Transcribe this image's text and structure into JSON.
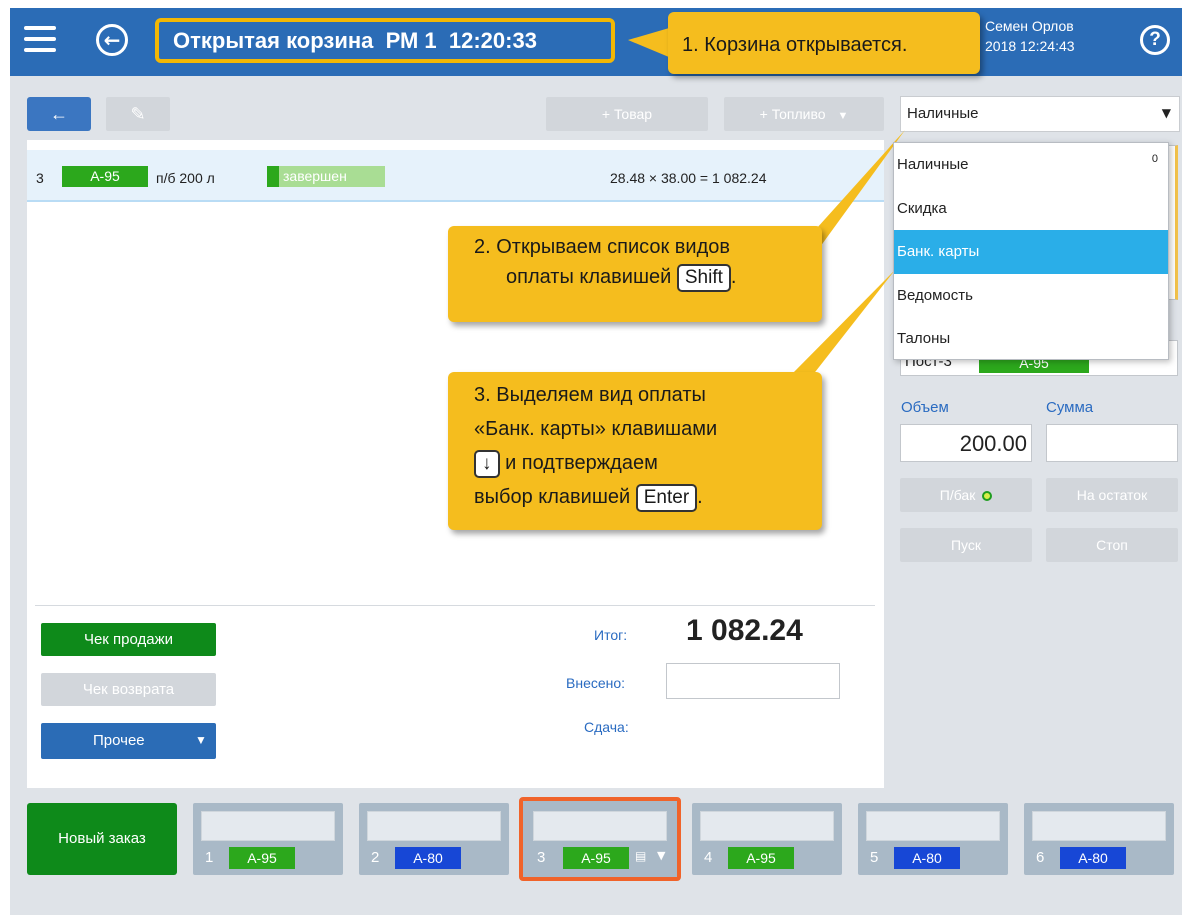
{
  "header": {
    "title": "Открытая корзина  РМ 1  12:20:33",
    "user_name": "Семен Орлов",
    "user_date": "2018 12:24:43",
    "help": "?"
  },
  "callouts": {
    "c1": "1. Корзина открывается.",
    "c2_line1": "2. Открываем список видов",
    "c2_line2": "оплаты клавишей",
    "c2_key": "Shift",
    "c2_end": ".",
    "c3_line1": "3. Выделяем вид оплаты",
    "c3_line2": "«Банк. карты» клавишами",
    "c3_key1": "↓",
    "c3_line3": "и подтверждаем",
    "c3_line4": "выбор клавишей",
    "c3_key2": "Enter",
    "c3_end": "."
  },
  "toolbar": {
    "back": "←",
    "edit": "✎",
    "add_product": "+ Товар",
    "add_fuel": "+ Топливо",
    "add_fuel_arrow": "▼"
  },
  "payment": {
    "selected": "Наличные",
    "arrow": "▼",
    "options": [
      "Наличные",
      "Скидка",
      "Банк. карты",
      "Ведомость",
      "Талоны"
    ],
    "highlighted": "Банк. карты",
    "cash_count": "0"
  },
  "row": {
    "num": "3",
    "fuel": "А-95",
    "desc": "п/б 200 л",
    "status": "завершен",
    "calc": "28.48 × 38.00 = 1 082.24"
  },
  "right_panel": {
    "post_label": "Пост-3",
    "post_fuel": "А-95",
    "volume_label": "Объем",
    "sum_label": "Сумма",
    "volume_value": "200.00",
    "sum_value": "",
    "full_tank": "П/бак",
    "remainder": "На остаток",
    "start": "Пуск",
    "stop": "Стоп"
  },
  "actions": {
    "sale_receipt": "Чек продажи",
    "return_receipt": "Чек возврата",
    "other": "Прочее",
    "other_arrow": "▼"
  },
  "totals": {
    "total_label": "Итог:",
    "total_value": "1 082.24",
    "paid_label": "Внесено:",
    "paid_value": "",
    "change_label": "Сдача:"
  },
  "orders": {
    "new_order": "Новый заказ",
    "tiles": [
      {
        "num": "1",
        "fuel": "А-95",
        "color": "green"
      },
      {
        "num": "2",
        "fuel": "А-80",
        "color": "blue"
      },
      {
        "num": "3",
        "fuel": "А-95",
        "color": "green"
      },
      {
        "num": "4",
        "fuel": "А-95",
        "color": "green"
      },
      {
        "num": "5",
        "fuel": "А-80",
        "color": "blue"
      },
      {
        "num": "6",
        "fuel": "А-80",
        "color": "blue"
      }
    ]
  },
  "colors": {
    "header_blue": "#2b6cb6",
    "callout_yellow": "#f5bd1e",
    "green": "#0e8a1a",
    "highlight": "#2aaee8",
    "active_tile_border": "#f0632a"
  }
}
